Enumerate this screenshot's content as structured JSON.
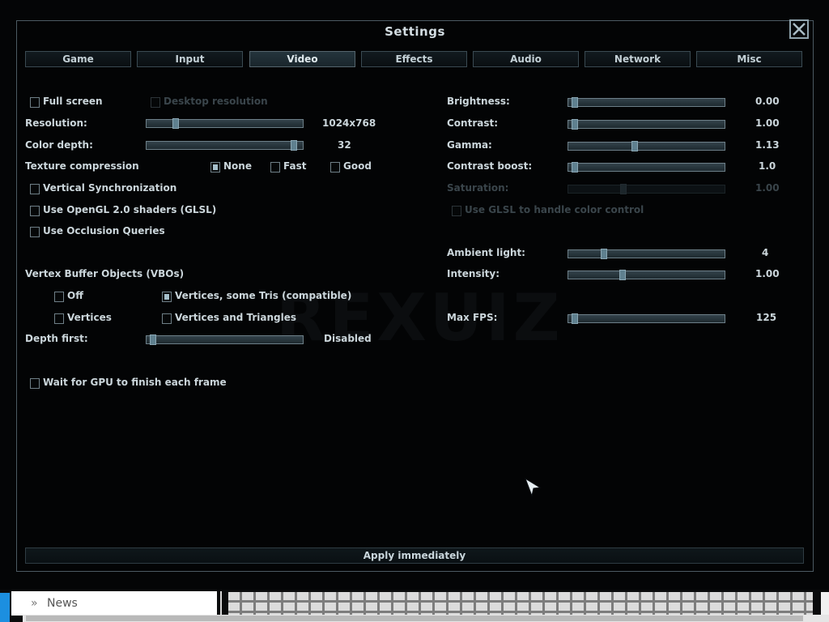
{
  "dialog": {
    "title": "Settings"
  },
  "tabs": [
    {
      "label": "Game"
    },
    {
      "label": "Input"
    },
    {
      "label": "Video",
      "active": true
    },
    {
      "label": "Effects"
    },
    {
      "label": "Audio"
    },
    {
      "label": "Network"
    },
    {
      "label": "Misc"
    }
  ],
  "left": {
    "full_screen": {
      "label": "Full screen",
      "checked": false
    },
    "desktop_resolution": {
      "label": "Desktop resolution",
      "enabled": false
    },
    "resolution": {
      "label": "Resolution:",
      "value": "1024x768"
    },
    "color_depth": {
      "label": "Color depth:",
      "value": "32"
    },
    "texture_compression": {
      "label": "Texture compression",
      "options": [
        {
          "label": "None",
          "selected": true
        },
        {
          "label": "Fast",
          "selected": false
        },
        {
          "label": "Good",
          "selected": false
        }
      ]
    },
    "vsync": {
      "label": "Vertical Synchronization",
      "checked": false
    },
    "glsl": {
      "label": "Use OpenGL 2.0 shaders (GLSL)",
      "checked": false
    },
    "occlusion": {
      "label": "Use Occlusion Queries",
      "checked": false
    },
    "vbo": {
      "label": "Vertex Buffer Objects (VBOs)",
      "options": [
        {
          "label": "Off",
          "selected": false
        },
        {
          "label": "Vertices, some Tris (compatible)",
          "selected": true
        },
        {
          "label": "Vertices",
          "selected": false
        },
        {
          "label": "Vertices and Triangles",
          "selected": false
        }
      ]
    },
    "depth_first": {
      "label": "Depth first:",
      "value": "Disabled"
    },
    "wait_gpu": {
      "label": "Wait for GPU to finish each frame",
      "checked": false
    }
  },
  "right": {
    "brightness": {
      "label": "Brightness:",
      "value": "0.00",
      "level": 0.0
    },
    "contrast": {
      "label": "Contrast:",
      "value": "1.00",
      "level": 0.0
    },
    "gamma": {
      "label": "Gamma:",
      "value": "1.13",
      "level": 0.42
    },
    "contrast_boost": {
      "label": "Contrast boost:",
      "value": "1.0",
      "level": 0.0
    },
    "saturation": {
      "label": "Saturation:",
      "value": "1.00",
      "level": 0.35,
      "enabled": false
    },
    "glsl_color": {
      "label": "Use GLSL to handle color control",
      "enabled": false
    },
    "ambient_light": {
      "label": "Ambient light:",
      "value": "4",
      "level": 0.22
    },
    "intensity": {
      "label": "Intensity:",
      "value": "1.00",
      "level": 0.35
    },
    "max_fps": {
      "label": "Max FPS:",
      "value": "125",
      "level": 0.0
    }
  },
  "watermark": "REXUIZ",
  "apply": {
    "label": "Apply immediately"
  },
  "taskbar": {
    "news_label": "News"
  }
}
